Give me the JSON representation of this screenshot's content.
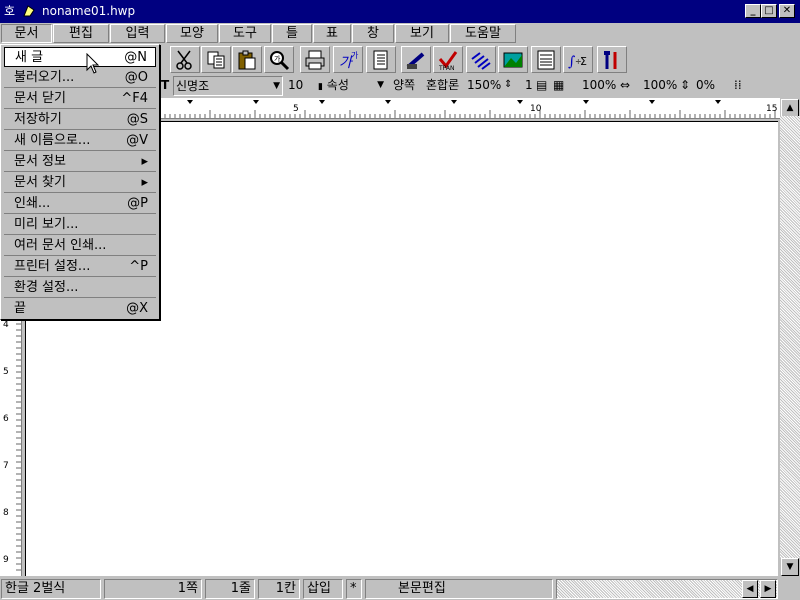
{
  "window": {
    "title": "noname01.hwp",
    "sys_glyph": "호"
  },
  "menubar": {
    "items": [
      {
        "label": "문서"
      },
      {
        "label": "편집"
      },
      {
        "label": "입력"
      },
      {
        "label": "모양"
      },
      {
        "label": "도구"
      },
      {
        "label": "틀"
      },
      {
        "label": "표"
      },
      {
        "label": "창"
      },
      {
        "label": "보기"
      },
      {
        "label": "도움말"
      }
    ]
  },
  "dropdown": {
    "items": [
      {
        "label": "새 글",
        "shortcut": "@N"
      },
      {
        "label": "불러오기...",
        "shortcut": "@O"
      },
      {
        "label": "문서 닫기",
        "shortcut": "^F4"
      },
      {
        "label": "저장하기",
        "shortcut": "@S"
      },
      {
        "label": "새 이름으로...",
        "shortcut": "@V"
      },
      {
        "label": "문서 정보",
        "shortcut": "▸"
      },
      {
        "label": "문서 찾기",
        "shortcut": "▸"
      },
      {
        "label": "인쇄...",
        "shortcut": "@P"
      },
      {
        "label": "미리 보기...",
        "shortcut": ""
      },
      {
        "label": "여러 문서 인쇄...",
        "shortcut": ""
      },
      {
        "label": "프린터 설정...",
        "shortcut": "^P"
      },
      {
        "label": "환경 설정...",
        "shortcut": ""
      },
      {
        "label": "끝",
        "shortcut": "@X"
      }
    ]
  },
  "format_bar": {
    "font_icon": "T",
    "font": "신명조",
    "size": "10",
    "attr": "속성",
    "align": "양쪽",
    "mode": "혼합",
    "mode_suffix": "론",
    "line_spacing": "150%",
    "columns": "1",
    "width_pct": "100%",
    "height_pct": "100%",
    "spacing_pct": "0%"
  },
  "ruler": {
    "labels": [
      "5",
      "10",
      "15"
    ]
  },
  "vruler": {
    "labels": [
      "4",
      "5",
      "6",
      "7",
      "8",
      "9"
    ]
  },
  "statusbar": {
    "lang": "한글 2벌식",
    "page": "1쪽",
    "line": "1줄",
    "col": "1칸",
    "insert": "삽입",
    "modified": "*",
    "mode": "본문편집"
  }
}
